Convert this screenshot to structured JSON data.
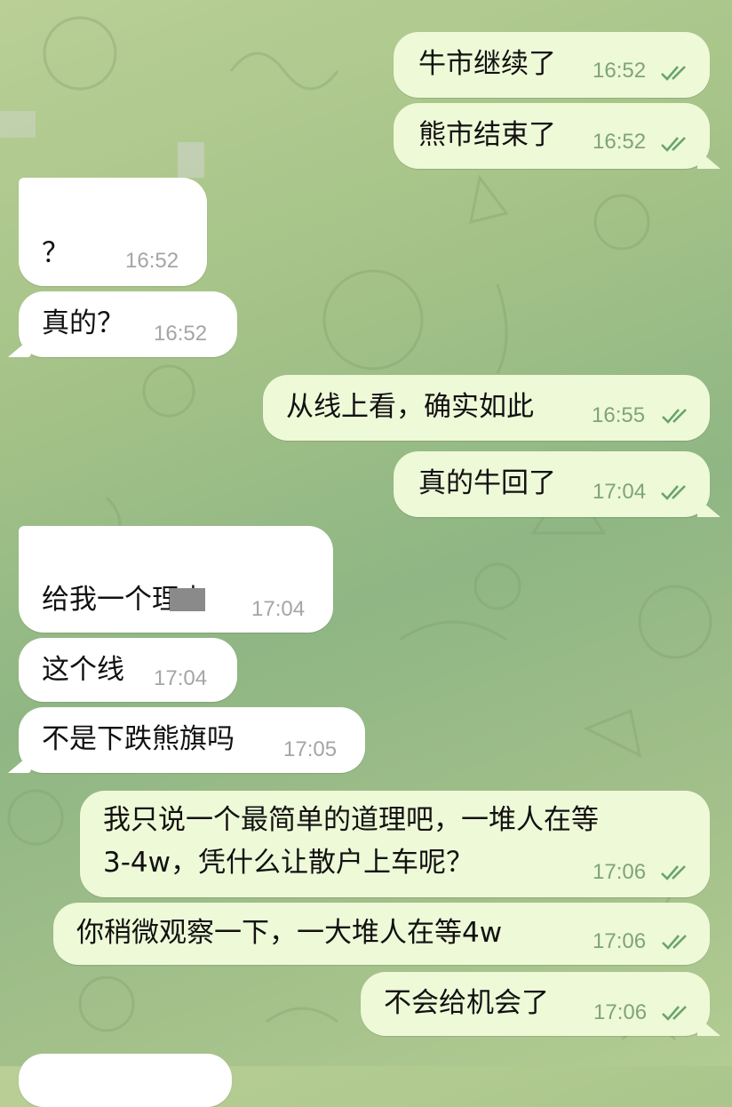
{
  "chat": {
    "messages": [
      {
        "side": "outgoing",
        "text": "牛市继续了",
        "time": "16:52",
        "read": true
      },
      {
        "side": "outgoing",
        "text": "熊市结束了",
        "time": "16:52",
        "read": true
      },
      {
        "side": "incoming",
        "text": "？",
        "time": "16:52"
      },
      {
        "side": "incoming",
        "text": "真的？",
        "time": "16:52"
      },
      {
        "side": "outgoing",
        "text": "从线上看，确实如此",
        "time": "16:55",
        "read": true
      },
      {
        "side": "outgoing",
        "text": "真的牛回了",
        "time": "17:04",
        "read": true
      },
      {
        "side": "incoming",
        "text": "给我一个理由",
        "time": "17:04"
      },
      {
        "side": "incoming",
        "text": "这个线",
        "time": "17:04"
      },
      {
        "side": "incoming",
        "text": "不是下跌熊旗吗",
        "time": "17:05"
      },
      {
        "side": "outgoing",
        "text_line1": "我只说一个最简单的道理吧，一堆人在等",
        "text_line2": "3-4w，凭什么让散户上车呢？",
        "time": "17:06",
        "read": true
      },
      {
        "side": "outgoing",
        "text": "你稍微观察一下，一大堆人在等4w",
        "time": "17:06",
        "read": true
      },
      {
        "side": "outgoing",
        "text": "不会给机会了",
        "time": "17:06",
        "read": true
      }
    ]
  },
  "colors": {
    "outgoing_bubble": "#eef9d8",
    "incoming_bubble": "#ffffff",
    "read_check": "#6aa46b",
    "wallpaper": "#a5c388"
  },
  "icons": {
    "read_receipt": "double-check-icon"
  }
}
